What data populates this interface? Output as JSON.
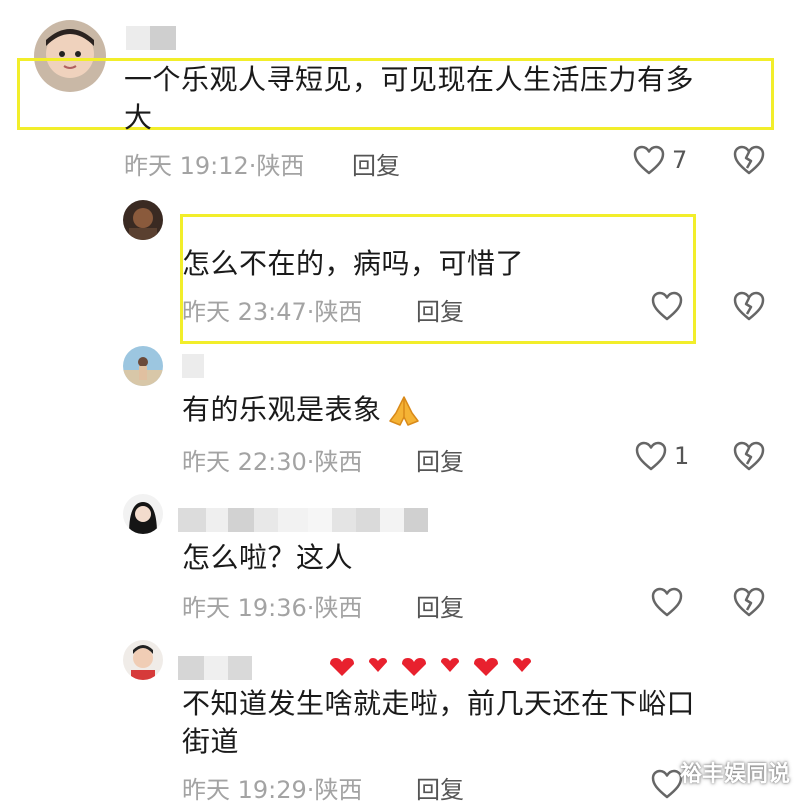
{
  "comments": [
    {
      "text_line1": "一个乐观人寻短见，可见现在人生活压力有多",
      "text_line2": "大",
      "time": "昨天 19:12",
      "location": "陕西",
      "reply": "回复",
      "likes": "7"
    },
    {
      "text_line1": "怎么不在的，病吗，可惜了",
      "time": "昨天 23:47",
      "location": "陕西",
      "reply": "回复",
      "likes": ""
    },
    {
      "text_line1": "有的乐观是表象",
      "time": "昨天 22:30",
      "location": "陕西",
      "reply": "回复",
      "likes": "1"
    },
    {
      "text_line1": "怎么啦？这人",
      "time": "昨天 19:36",
      "location": "陕西",
      "reply": "回复",
      "likes": ""
    },
    {
      "text_line1": "不知道发生啥就走啦，前几天还在下峪口",
      "text_line2": "街道",
      "time": "昨天 19:29",
      "location": "陕西",
      "reply": "回复",
      "likes": ""
    }
  ],
  "separator": "·",
  "watermark": "裕丰娱同说",
  "colors": {
    "highlight": "#f2ee2a",
    "meta": "#a3a3a3",
    "heart_red": "#e8212e"
  }
}
